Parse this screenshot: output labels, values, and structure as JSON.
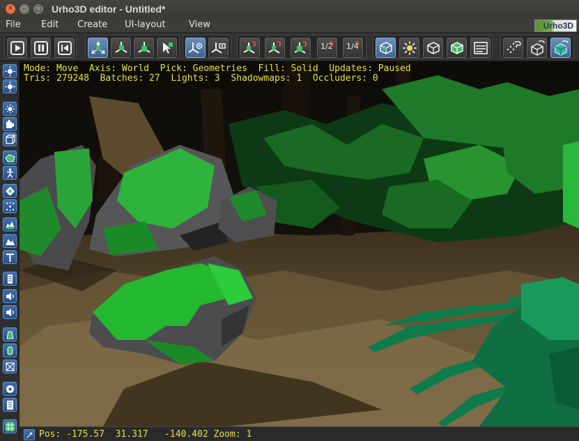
{
  "window": {
    "title": "Urho3D editor - Untitled*",
    "close_glyph": "✕",
    "minimize_glyph": "–",
    "maximize_glyph": "□"
  },
  "menu": {
    "items": [
      {
        "label": "File"
      },
      {
        "label": "Edit"
      },
      {
        "label": "Create"
      },
      {
        "label": "UI-layout"
      },
      {
        "label": "View"
      }
    ],
    "logo_text": "Urho3D"
  },
  "toolbar": {
    "groups": [
      {
        "name": "playback",
        "buttons": [
          "play-icon",
          "pause-icon",
          "rewind-icon"
        ]
      },
      {
        "name": "edit-mode",
        "buttons": [
          "move-icon",
          "rotate-icon",
          "scale-icon",
          "select-icon"
        ]
      },
      {
        "name": "axis-mode",
        "buttons": [
          "world-axis-icon",
          "local-axis-icon"
        ]
      },
      {
        "name": "snap",
        "buttons": [
          "move-snap-icon",
          "rotate-snap-icon",
          "scale-snap-icon",
          "snap-half-icon",
          "snap-quarter-icon"
        ]
      },
      {
        "name": "pick-mode",
        "buttons": [
          "pick-geometries-icon",
          "pick-lights-icon",
          "pick-zones-icon",
          "pick-rigidbodies-icon",
          "pick-ui-icon"
        ]
      },
      {
        "name": "fill-mode",
        "buttons": [
          "fill-point-icon",
          "fill-wireframe-icon",
          "fill-solid-icon"
        ]
      }
    ],
    "active": [
      "move-icon",
      "world-axis-icon",
      "pick-geometries-icon",
      "fill-solid-icon"
    ],
    "snap_half_label": "1/2",
    "snap_quarter_label": "1/4"
  },
  "left_toolbar": {
    "buttons": [
      "scene-node-icon",
      "local-node-icon",
      "light-icon",
      "camera-icon",
      "box-icon",
      "static-model-icon",
      "animated-model-icon",
      "billboard-icon",
      "particle-icon",
      "terrain-icon",
      "zone-icon",
      "text-icon",
      "sound-source-icon",
      "sound-listener-icon",
      "speaker-icon",
      "rigid-body-icon",
      "collision-shape-icon",
      "constraint-icon",
      "navigation-icon",
      "script-icon",
      "grid-icon"
    ]
  },
  "viewport": {
    "stats_line1": "Mode: Move  Axis: World  Pick: Geometries  Fill: Solid  Updates: Paused",
    "stats_line2": "Tris: 279248  Batches: 27  Lights: 3  Shadowmaps: 1  Occluders: 0"
  },
  "status": {
    "pos_label": "Pos:",
    "pos_x": "-175.57",
    "pos_y": "31.317",
    "pos_z": "-140.402",
    "zoom_label": "Zoom:",
    "zoom_value": "1"
  },
  "colors": {
    "stats_text": "#e3e04a",
    "active_button": "#3e638f",
    "foliage": "#1f8a2e",
    "ground": "#6b5a3a"
  }
}
